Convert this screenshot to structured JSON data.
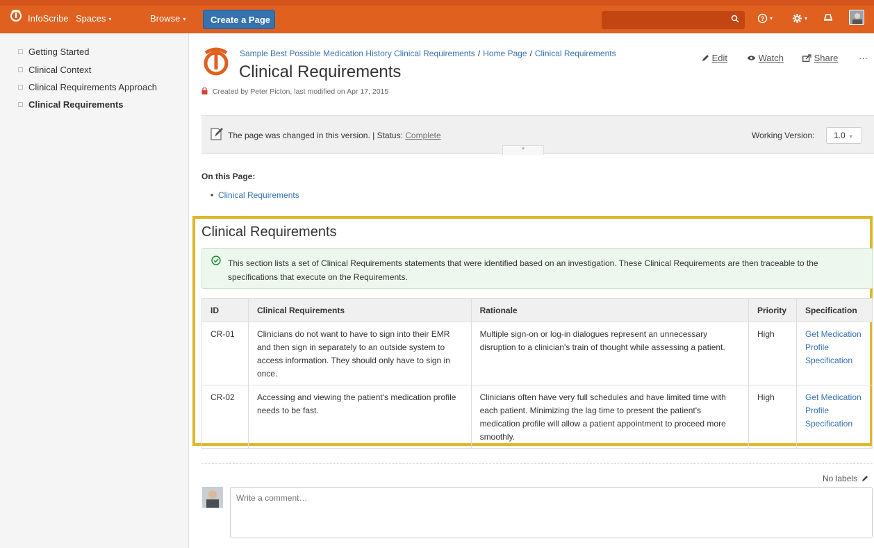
{
  "nav": {
    "brand": "InfoScribe",
    "spaces": "Spaces",
    "browse": "Browse",
    "create": "Create a Page",
    "caret": "▾",
    "help_icon": "?",
    "settings_icon": "gear",
    "notifications_icon": "bell"
  },
  "sidebar": {
    "items": [
      {
        "label": "Getting Started"
      },
      {
        "label": "Clinical Context"
      },
      {
        "label": "Clinical Requirements Approach"
      },
      {
        "label": "Clinical Requirements"
      }
    ]
  },
  "breadcrumb": {
    "items": [
      "Sample Best Possible Medication History Clinical Requirements",
      "Home Page",
      "Clinical Requirements"
    ],
    "sep": "/"
  },
  "page": {
    "title": "Clinical Requirements",
    "byline": "Created by Peter Picton, last modified on Apr 17, 2015"
  },
  "actions": {
    "edit": "Edit",
    "watch": "Watch",
    "share": "Share",
    "more": "···"
  },
  "status": {
    "prefix": "The page was changed in this version. | Status: ",
    "status_value": "Complete",
    "working_version_label": "Working Version:",
    "working_version_value": "1.0"
  },
  "toc": {
    "heading": "On this Page:",
    "links": [
      "Clinical Requirements"
    ]
  },
  "section": {
    "title": "Clinical Requirements",
    "info": "This section lists a set of Clinical Requirements statements that were identified based on an investigation. These Clinical Requirements are then traceable to the specifications that execute on the Requirements."
  },
  "table": {
    "headers": [
      "ID",
      "Clinical Requirements",
      "Rationale",
      "Priority",
      "Specification"
    ],
    "rows": [
      {
        "id": "CR-01",
        "requirement": "Clinicians do not want to have to sign into their EMR and then sign in separately to an outside system to access information. They should only have to sign in once.",
        "rationale": "Multiple sign-on or log-in dialogues represent an unnecessary disruption to a clinician's train of thought while assessing a patient.",
        "priority": "High",
        "specification": "Get Medication Profile Specification"
      },
      {
        "id": "CR-02",
        "requirement": "Accessing and viewing the patient's medication profile needs to be fast.",
        "rationale": "Clinicians often have very full schedules and have limited time with each patient. Minimizing the lag time to present the patient's medication profile will allow a patient appointment to proceed more smoothly.",
        "priority": "High",
        "specification": "Get Medication Profile Specification"
      }
    ]
  },
  "footer": {
    "labels": "No labels",
    "comment_placeholder": "Write a comment…"
  },
  "colors": {
    "header": "#e0601f",
    "create_button": "#3572b0",
    "link": "#3572b0",
    "highlight": "#e0b72a",
    "info_bg": "#eef7ee"
  }
}
